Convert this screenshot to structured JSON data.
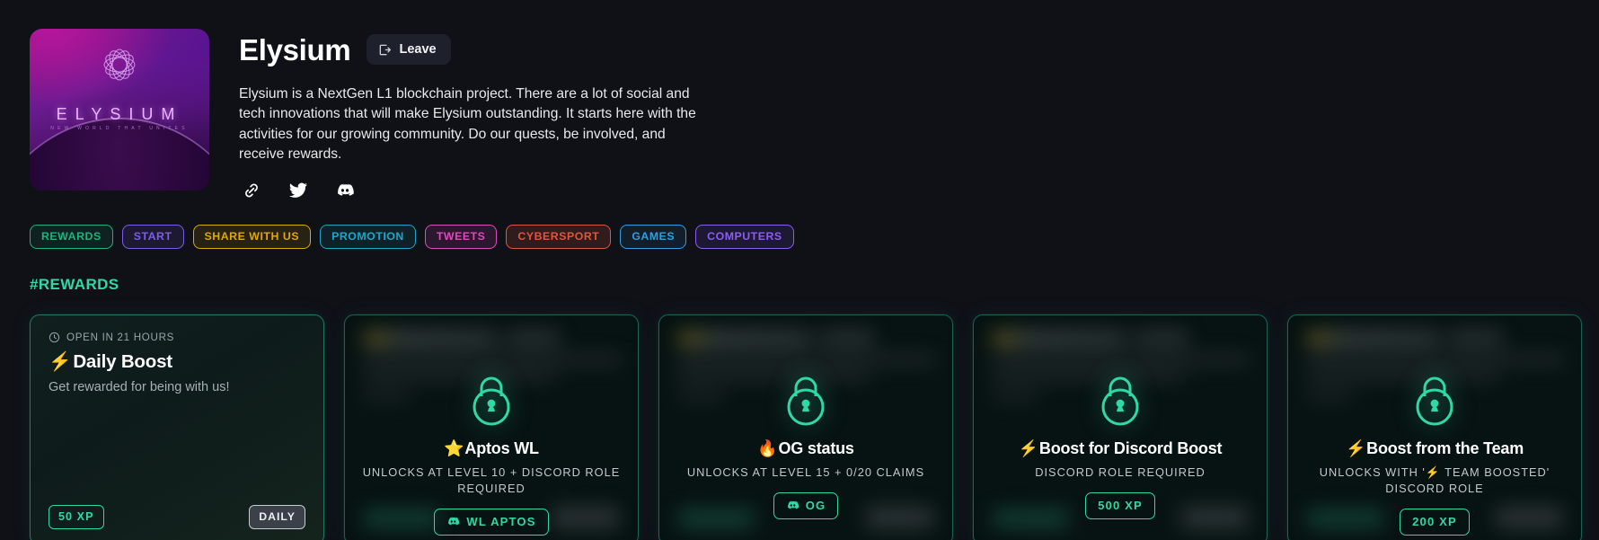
{
  "project": {
    "name": "Elysium",
    "logo_wordmark": "ELYSIUM",
    "logo_subwordmark": "NEW WORLD THAT UNITES",
    "description": "Elysium is a NextGen L1 blockchain project. There are a lot of social and tech innovations that will make Elysium outstanding. It starts here with the activities for our growing community. Do our quests, be involved, and receive rewards.",
    "leave_label": "Leave",
    "leave_icon": "logout-icon",
    "socials": [
      {
        "name": "link-icon",
        "label": "Website"
      },
      {
        "name": "twitter-icon",
        "label": "Twitter"
      },
      {
        "name": "discord-icon",
        "label": "Discord"
      }
    ]
  },
  "tags": [
    {
      "label": "REWARDS",
      "color": "#18b57d"
    },
    {
      "label": "START",
      "color": "#7c5cf0"
    },
    {
      "label": "SHARE WITH US",
      "color": "#e0a800"
    },
    {
      "label": "PROMOTION",
      "color": "#18a8c9"
    },
    {
      "label": "TWEETS",
      "color": "#e048c0"
    },
    {
      "label": "CYBERSPORT",
      "color": "#e2553a"
    },
    {
      "label": "GAMES",
      "color": "#2f9fe0"
    },
    {
      "label": "COMPUTERS",
      "color": "#8b5cf6"
    }
  ],
  "section": {
    "title": "#REWARDS",
    "accent": "#2fd9a5"
  },
  "cards": [
    {
      "state": "open",
      "status": "OPEN IN 21 HOURS",
      "status_icon": "clock-icon",
      "emoji": "⚡",
      "title": "Daily Boost",
      "subtitle": "Get rewarded for being with us!",
      "xp_badge": "50 XP",
      "right_badge": "DAILY"
    },
    {
      "state": "locked",
      "lock_icon": "lock-icon",
      "emoji": "⭐",
      "title": "Aptos WL",
      "requirement": "UNLOCKS AT LEVEL 10 + DISCORD ROLE REQUIRED",
      "badge_label": "WL APTOS",
      "badge_icon": "discord-icon"
    },
    {
      "state": "locked",
      "lock_icon": "lock-icon",
      "emoji": "🔥",
      "title": "OG status",
      "requirement": "UNLOCKS AT LEVEL 15 + 0/20 CLAIMS",
      "badge_label": "OG",
      "badge_icon": "discord-icon"
    },
    {
      "state": "locked",
      "lock_icon": "lock-icon",
      "emoji": "⚡",
      "title": "Boost for Discord Boost",
      "requirement": "DISCORD ROLE REQUIRED",
      "badge_label": "500 XP",
      "badge_icon": "none"
    },
    {
      "state": "locked",
      "lock_icon": "lock-icon",
      "emoji": "⚡",
      "title": "Boost from the Team",
      "requirement_prefix": "UNLOCKS WITH '",
      "requirement_emoji": "⚡",
      "requirement_suffix": " TEAM BOOSTED' DISCORD ROLE",
      "badge_label": "200 XP",
      "badge_icon": "none"
    }
  ]
}
